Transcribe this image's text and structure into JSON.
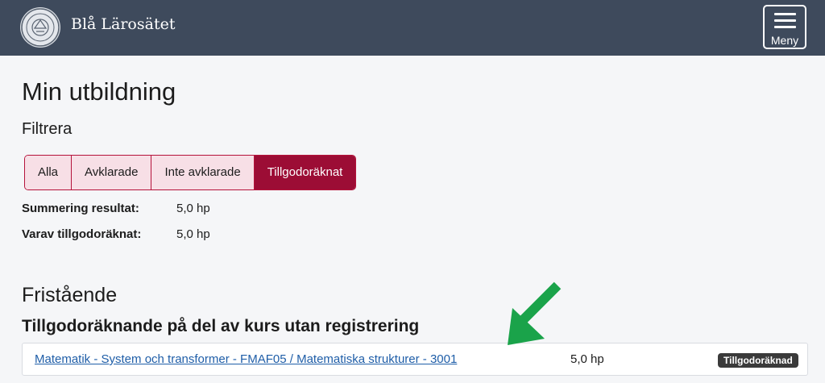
{
  "header": {
    "brand": "Blå Lärosätet",
    "logo_icon": "university-seal-logo",
    "menu_label": "Meny",
    "background": "#3e4a5c"
  },
  "page": {
    "title": "Min utbildning",
    "filter_heading": "Filtrera",
    "filters": [
      "Alla",
      "Avklarade",
      "Inte avklarade",
      "Tillgodoräknat"
    ],
    "active_filter": "Tillgodoräknat",
    "summary": [
      {
        "label": "Summering resultat:",
        "value": "5,0 hp"
      },
      {
        "label": "Varav tillgodoräknat:",
        "value": "5,0 hp"
      }
    ]
  },
  "section": {
    "title": "Fristående",
    "subtitle": "Tillgodoräknande på del av kurs utan registrering",
    "courses": [
      {
        "name": "Matematik - System och transformer - FMAF05 / Matematiska strukturer - 3001",
        "credits": "5,0 hp",
        "status": "Tillgodoräknad"
      }
    ]
  },
  "annotation": {
    "icon": "green-arrow-icon",
    "color": "#1aa34a"
  },
  "colors": {
    "accent": "#9c0d35",
    "filter_bg": "#f7dfe6",
    "link": "#1f5ea8",
    "badge": "#3a3a3a"
  }
}
